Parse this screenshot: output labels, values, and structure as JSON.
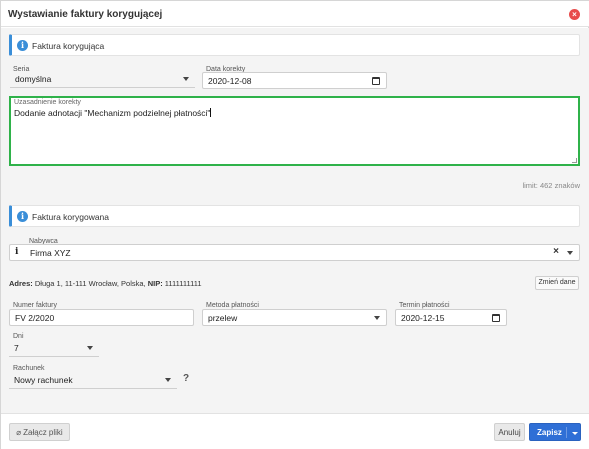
{
  "dialog": {
    "title": "Wystawianie faktury korygującej",
    "close_glyph": "×"
  },
  "correcting_panel": {
    "title": "Faktura korygująca",
    "icon": "i"
  },
  "series": {
    "label": "Seria",
    "value": "domyślna"
  },
  "correction_date": {
    "label": "Data korekty",
    "value": "2020-12-08"
  },
  "justification": {
    "label": "Uzasadnienie korekty",
    "value": "Dodanie adnotacji \"Mechanizm podzielnej płatności\""
  },
  "limit_text": "limit: 462 znaków",
  "corrected_panel": {
    "title": "Faktura korygowana",
    "icon": "i"
  },
  "buyer": {
    "label": "Nabywca",
    "value": "Firma XYZ",
    "info_glyph": "i",
    "clear_glyph": "×"
  },
  "address": {
    "prefix": "Adres:",
    "text": "Długa 1, 11-111 Wrocław, Polska,",
    "nip_label": "NIP:",
    "nip_value": "1111111111"
  },
  "change_data_button": "Zmień dane",
  "invoice_number": {
    "label": "Numer faktury",
    "value": "FV 2/2020"
  },
  "payment_method": {
    "label": "Metoda płatności",
    "value": "przelew"
  },
  "payment_term": {
    "label": "Termin płatności",
    "value": "2020-12-15"
  },
  "days": {
    "label": "Dni",
    "value": "7"
  },
  "account": {
    "label": "Rachunek",
    "value": "Nowy rachunek",
    "help_glyph": "?"
  },
  "footer": {
    "attach_label": "Załącz pliki",
    "cancel_label": "Anuluj",
    "save_label": "Zapisz"
  },
  "colors": {
    "accent_blue": "#3a8ed8",
    "focus_green": "#2fb24a",
    "save_blue": "#2f6fd6",
    "close_red": "#e84c4c"
  }
}
